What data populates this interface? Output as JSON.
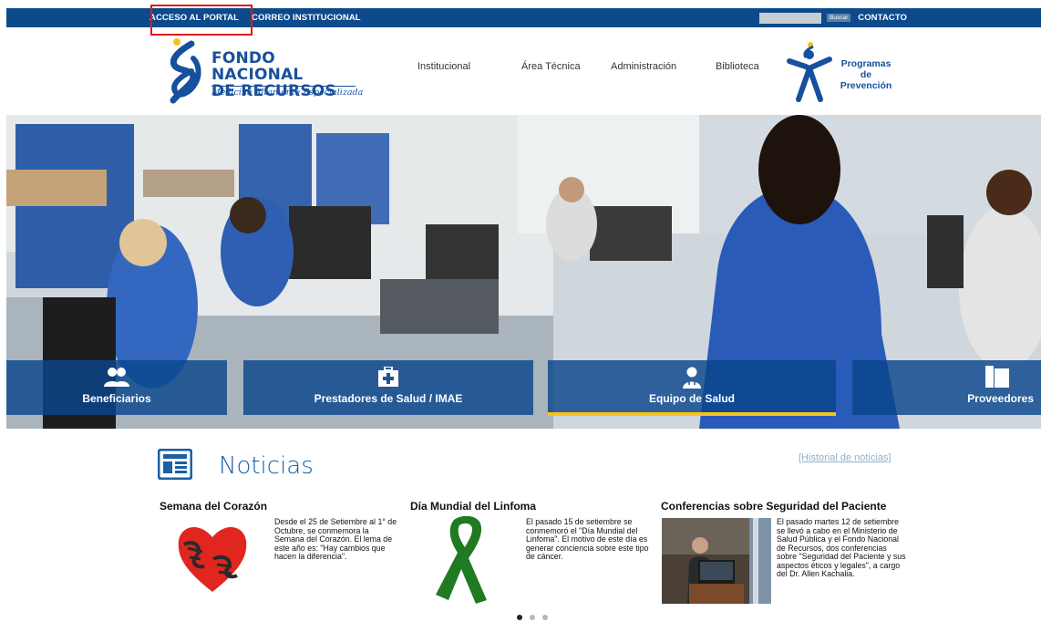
{
  "topbar": {
    "portal": "ACCESO AL PORTAL",
    "correo": "CORREO INSTITUCIONAL",
    "search_button": "Buscar",
    "contact": "CONTACTO"
  },
  "logo": {
    "line1": "FONDO NACIONAL",
    "line2": "DE RECURSOS",
    "tagline": "Medicina Altamente Especializada"
  },
  "nav": {
    "institucional": "Institucional",
    "area_tecnica": "Área Técnica",
    "administracion": "Administración",
    "biblioteca": "Biblioteca",
    "programas_line1": "Programas de",
    "programas_line2": "Prevención"
  },
  "categories": {
    "beneficiarios": "Beneficiarios",
    "prestadores": "Prestadores de Salud / IMAE",
    "equipo": "Equipo de Salud",
    "proveedores": "Proveedores"
  },
  "news": {
    "title": "Noticias",
    "historial": "[Historial de noticias]",
    "items": [
      {
        "title": "Semana del Corazón",
        "text": "Desde el 25 de Setiembre al 1° de Octubre, se conmemora la Semana del Corazón. El lema de este año es: \"Hay cambios que hacen la diferencia\"."
      },
      {
        "title": "Día Mundial del Linfoma",
        "text": "El pasado 15 de setiembre se conmemoró el \"Día Mundial del Linfoma\". El motivo de este día es generar conciencia sobre este tipo de cáncer."
      },
      {
        "title": "Conferencias sobre Seguridad del Paciente",
        "text": "El pasado martes 12 de setiembre se llevó a cabo en el Ministerio de Salud Pública y el Fondo Nacional de Recursos, dos conferencias sobre \"Seguridad del Paciente y sus aspectos éticos y legales\", a cargo del Dr. Allen Kachalia."
      }
    ]
  },
  "colors": {
    "brand_blue": "#0d4a8c",
    "accent_yellow": "#f5c31a",
    "highlight_red": "#e0191e"
  }
}
